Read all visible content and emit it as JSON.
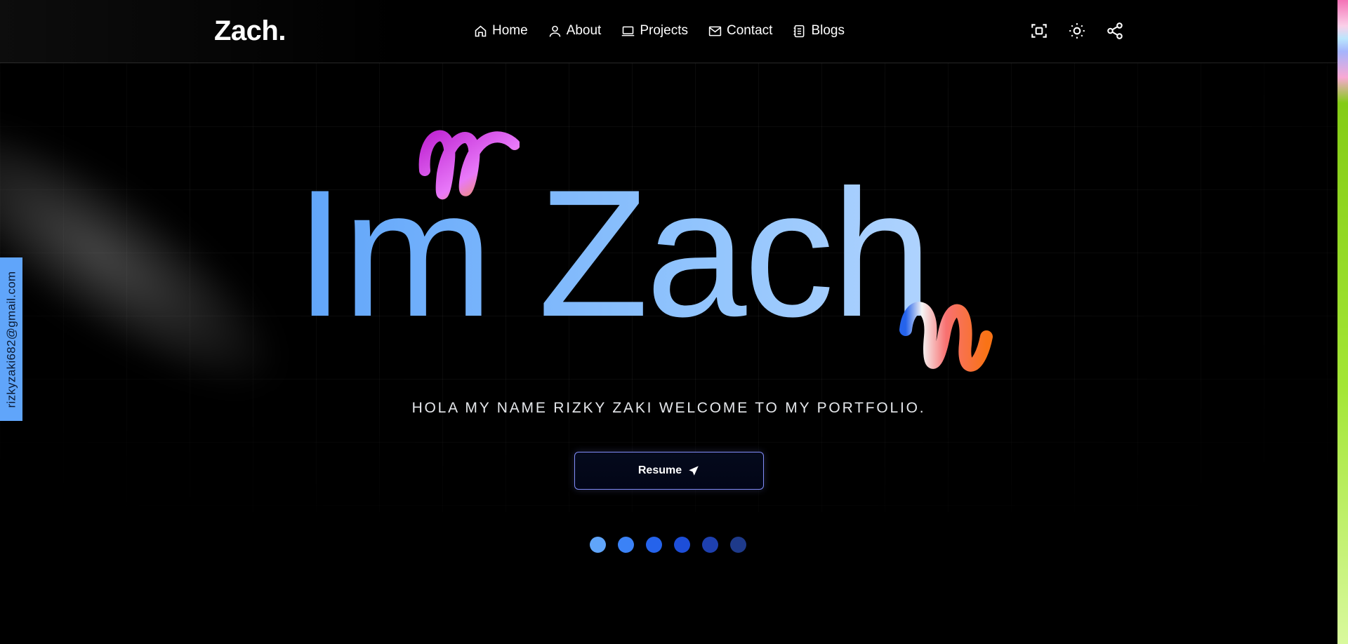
{
  "header": {
    "logo": "Zach.",
    "nav": [
      {
        "label": "Home",
        "icon": "home-icon"
      },
      {
        "label": "About",
        "icon": "user-icon"
      },
      {
        "label": "Projects",
        "icon": "laptop-icon"
      },
      {
        "label": "Contact",
        "icon": "mail-icon"
      },
      {
        "label": "Blogs",
        "icon": "notebook-icon"
      }
    ],
    "tools": [
      "scan-icon",
      "sun-icon",
      "share-icon"
    ]
  },
  "side": {
    "email": "rizkyzaki682@gmail.com"
  },
  "hero": {
    "title": "Im Zach",
    "subtitle": "HOLA MY NAME RIZKY ZAKI WELCOME TO MY PORTFOLIO.",
    "resume_label": "Resume"
  },
  "dots": [
    "#60a5fa",
    "#3b82f6",
    "#2563eb",
    "#1d4ed8",
    "#1e40af",
    "#1e3a8a"
  ],
  "colors": {
    "accent": "#60a5fa",
    "button_border": "#818cf8",
    "background": "#000000"
  }
}
